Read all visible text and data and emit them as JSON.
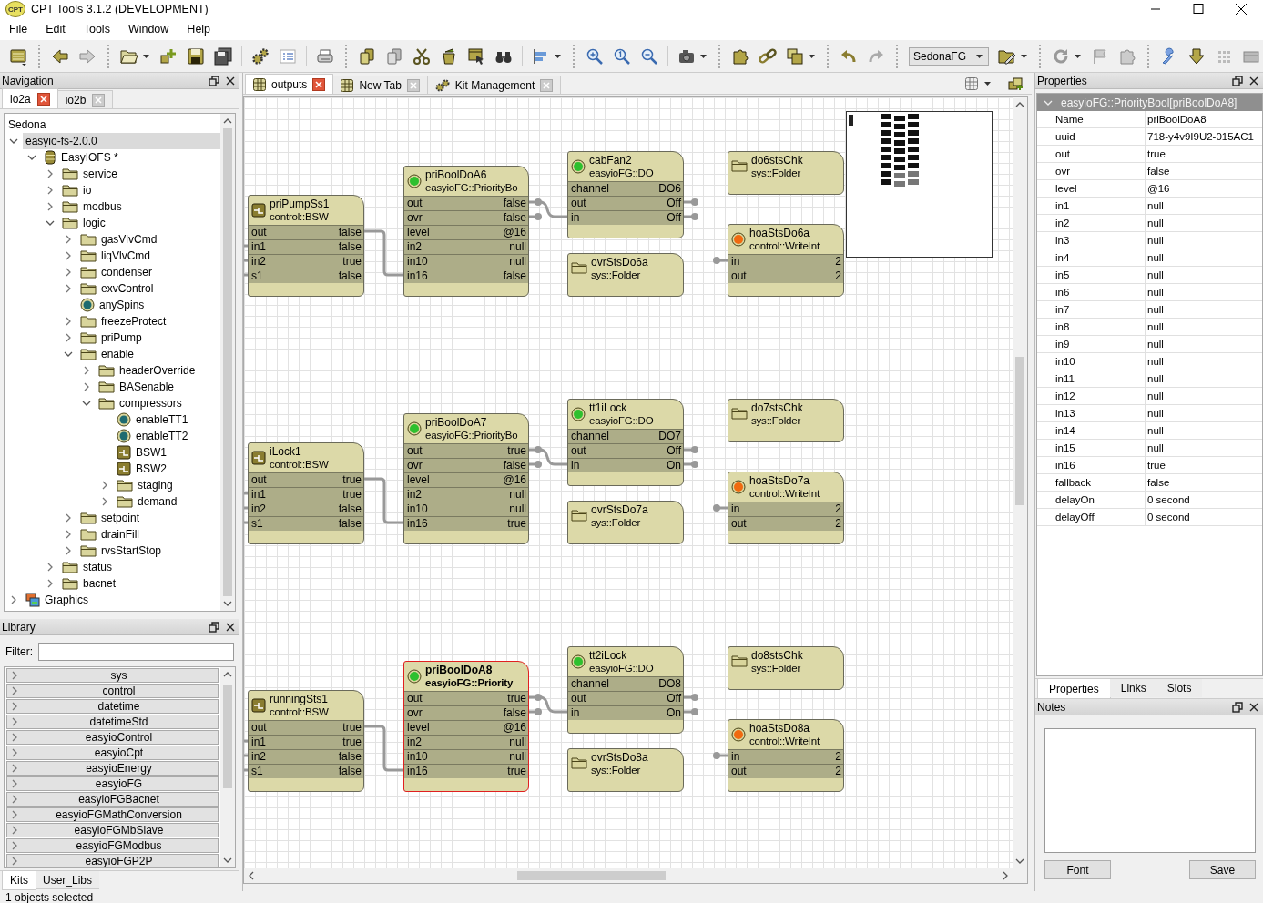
{
  "window": {
    "title": "CPT Tools 3.1.2 (DEVELOPMENT)",
    "logo_text": "CPT"
  },
  "menu": [
    "File",
    "Edit",
    "Tools",
    "Window",
    "Help"
  ],
  "toolbar": {
    "platform": "SedonaFG"
  },
  "navigation": {
    "title": "Navigation",
    "tabs": [
      {
        "label": "io2a",
        "selected": true
      },
      {
        "label": "io2b",
        "selected": false
      }
    ],
    "root": "Sedona",
    "tree": [
      {
        "label": "easyio-fs-2.0.0",
        "expanded": true,
        "selected": true,
        "children": [
          {
            "label": "EasyIOFS *",
            "kind": "database",
            "expanded": true,
            "selected": false,
            "children": [
              {
                "label": "service",
                "kind": "folder",
                "expanded": false,
                "selected": false
              },
              {
                "label": "io",
                "kind": "folder",
                "expanded": false,
                "selected": false
              },
              {
                "label": "modbus",
                "kind": "folder",
                "expanded": false,
                "selected": false
              },
              {
                "label": "logic",
                "kind": "folder",
                "expanded": true,
                "selected": false,
                "children": [
                  {
                    "label": "gasVlvCmd",
                    "kind": "folder",
                    "expanded": false,
                    "selected": false
                  },
                  {
                    "label": "liqVlvCmd",
                    "kind": "folder",
                    "expanded": false,
                    "selected": false
                  },
                  {
                    "label": "condenser",
                    "kind": "folder",
                    "expanded": false,
                    "selected": false
                  },
                  {
                    "label": "exvControl",
                    "kind": "folder",
                    "expanded": false,
                    "selected": false
                  },
                  {
                    "label": "anySpins",
                    "kind": "point",
                    "selected": false
                  },
                  {
                    "label": "freezeProtect",
                    "kind": "folder",
                    "expanded": false,
                    "selected": false
                  },
                  {
                    "label": "priPump",
                    "kind": "folder",
                    "expanded": false,
                    "selected": false
                  },
                  {
                    "label": "enable",
                    "kind": "folder",
                    "expanded": true,
                    "selected": false,
                    "children": [
                      {
                        "label": "headerOverride",
                        "kind": "folder",
                        "expanded": false,
                        "selected": false
                      },
                      {
                        "label": "BASenable",
                        "kind": "folder",
                        "expanded": false,
                        "selected": false
                      },
                      {
                        "label": "compressors",
                        "kind": "folder",
                        "expanded": true,
                        "selected": false,
                        "children": [
                          {
                            "label": "enableTT1",
                            "kind": "point",
                            "selected": false
                          },
                          {
                            "label": "enableTT2",
                            "kind": "point",
                            "selected": false
                          },
                          {
                            "label": "BSW1",
                            "kind": "bsw",
                            "selected": false
                          },
                          {
                            "label": "BSW2",
                            "kind": "bsw",
                            "selected": false
                          },
                          {
                            "label": "staging",
                            "kind": "folder",
                            "expanded": false,
                            "selected": false
                          },
                          {
                            "label": "demand",
                            "kind": "folder",
                            "expanded": false,
                            "selected": false
                          }
                        ]
                      }
                    ]
                  },
                  {
                    "label": "setpoint",
                    "kind": "folder",
                    "expanded": false,
                    "selected": false
                  },
                  {
                    "label": "drainFill",
                    "kind": "folder",
                    "expanded": false,
                    "selected": false
                  },
                  {
                    "label": "rvsStartStop",
                    "kind": "folder",
                    "expanded": false,
                    "selected": false
                  }
                ]
              },
              {
                "label": "status",
                "kind": "folder",
                "expanded": false,
                "selected": false
              },
              {
                "label": "bacnet",
                "kind": "folder",
                "expanded": false,
                "selected": false
              }
            ]
          }
        ]
      },
      {
        "label": "Graphics",
        "kind": "graphics",
        "expanded": false,
        "selected": false
      }
    ]
  },
  "library": {
    "title": "Library",
    "filter_label": "Filter:",
    "kits": [
      "sys",
      "control",
      "datetime",
      "datetimeStd",
      "easyioControl",
      "easyioCpt",
      "easyioEnergy",
      "easyioFG",
      "easyioFGBacnet",
      "easyioFGMathConversion",
      "easyioFGMbSlave",
      "easyioFGModbus",
      "easyioFGP2P"
    ],
    "tabs": [
      {
        "label": "Kits",
        "selected": true
      },
      {
        "label": "User_Libs",
        "selected": false
      }
    ]
  },
  "editor_tabs": [
    {
      "label": "outputs",
      "kind": "grid",
      "selected": true
    },
    {
      "label": "New Tab",
      "kind": "grid",
      "selected": false
    },
    {
      "label": "Kit Management",
      "kind": "gears",
      "selected": false
    }
  ],
  "nodes": [
    {
      "name": "priPumpSs1",
      "type": "control::BSW",
      "kind": "bsw",
      "selected": false,
      "rows": [
        {
          "label": "out",
          "value": "false"
        },
        {
          "label": "in1",
          "value": "false"
        },
        {
          "label": "in2",
          "value": "true"
        },
        {
          "label": "s1",
          "value": "false"
        }
      ]
    },
    {
      "name": "priBoolDoA6",
      "type": "easyioFG::PriorityBo",
      "kind": "ok",
      "selected": false,
      "rows": [
        {
          "label": "out",
          "value": "false"
        },
        {
          "label": "ovr",
          "value": "false"
        },
        {
          "label": "level",
          "value": "@16"
        },
        {
          "label": "in2",
          "value": "null"
        },
        {
          "label": "in10",
          "value": "null"
        },
        {
          "label": "in16",
          "value": "false"
        }
      ]
    },
    {
      "name": "cabFan2",
      "type": "easyioFG::DO",
      "kind": "ok",
      "selected": false,
      "rows": [
        {
          "label": "channel",
          "value": "DO6"
        },
        {
          "label": "out",
          "value": "Off"
        },
        {
          "label": "in",
          "value": "Off"
        }
      ]
    },
    {
      "name": "ovrStsDo6a",
      "type": "sys::Folder",
      "kind": "folder",
      "selected": false
    },
    {
      "name": "do6stsChk",
      "type": "sys::Folder",
      "kind": "folder",
      "selected": false
    },
    {
      "name": "hoaStsDo6a",
      "type": "control::WriteInt",
      "kind": "alarm",
      "selected": false,
      "rows": [
        {
          "label": "in",
          "value": "2"
        },
        {
          "label": "out",
          "value": "2"
        }
      ]
    },
    {
      "name": "iLock1",
      "type": "control::BSW",
      "kind": "bsw",
      "selected": false,
      "rows": [
        {
          "label": "out",
          "value": "true"
        },
        {
          "label": "in1",
          "value": "true"
        },
        {
          "label": "in2",
          "value": "false"
        },
        {
          "label": "s1",
          "value": "false"
        }
      ]
    },
    {
      "name": "priBoolDoA7",
      "type": "easyioFG::PriorityBo",
      "kind": "ok",
      "selected": false,
      "rows": [
        {
          "label": "out",
          "value": "true"
        },
        {
          "label": "ovr",
          "value": "false"
        },
        {
          "label": "level",
          "value": "@16"
        },
        {
          "label": "in2",
          "value": "null"
        },
        {
          "label": "in10",
          "value": "null"
        },
        {
          "label": "in16",
          "value": "true"
        }
      ]
    },
    {
      "name": "tt1iLock",
      "type": "easyioFG::DO",
      "kind": "ok",
      "selected": false,
      "rows": [
        {
          "label": "channel",
          "value": "DO7"
        },
        {
          "label": "out",
          "value": "Off"
        },
        {
          "label": "in",
          "value": "On"
        }
      ]
    },
    {
      "name": "ovrStsDo7a",
      "type": "sys::Folder",
      "kind": "folder",
      "selected": false
    },
    {
      "name": "do7stsChk",
      "type": "sys::Folder",
      "kind": "folder",
      "selected": false
    },
    {
      "name": "hoaStsDo7a",
      "type": "control::WriteInt",
      "kind": "alarm",
      "selected": false,
      "rows": [
        {
          "label": "in",
          "value": "2"
        },
        {
          "label": "out",
          "value": "2"
        }
      ]
    },
    {
      "name": "runningSts1",
      "type": "control::BSW",
      "kind": "bsw",
      "selected": false,
      "rows": [
        {
          "label": "out",
          "value": "true"
        },
        {
          "label": "in1",
          "value": "true"
        },
        {
          "label": "in2",
          "value": "false"
        },
        {
          "label": "s1",
          "value": "false"
        }
      ]
    },
    {
      "name": "priBoolDoA8",
      "type": "easyioFG::Priority",
      "kind": "ok",
      "selected": true,
      "rows": [
        {
          "label": "out",
          "value": "true"
        },
        {
          "label": "ovr",
          "value": "false"
        },
        {
          "label": "level",
          "value": "@16"
        },
        {
          "label": "in2",
          "value": "null"
        },
        {
          "label": "in10",
          "value": "null"
        },
        {
          "label": "in16",
          "value": "true"
        }
      ]
    },
    {
      "name": "tt2iLock",
      "type": "easyioFG::DO",
      "kind": "ok",
      "selected": false,
      "rows": [
        {
          "label": "channel",
          "value": "DO8"
        },
        {
          "label": "out",
          "value": "Off"
        },
        {
          "label": "in",
          "value": "On"
        }
      ]
    },
    {
      "name": "ovrStsDo8a",
      "type": "sys::Folder",
      "kind": "folder",
      "selected": false
    },
    {
      "name": "do8stsChk",
      "type": "sys::Folder",
      "kind": "folder",
      "selected": false
    },
    {
      "name": "hoaStsDo8a",
      "type": "control::WriteInt",
      "kind": "alarm",
      "selected": false,
      "rows": [
        {
          "label": "in",
          "value": "2"
        },
        {
          "label": "out",
          "value": "2"
        }
      ]
    }
  ],
  "properties": {
    "title": "Properties",
    "object": "easyioFG::PriorityBool[priBoolDoA8]",
    "rows": [
      {
        "name": "Name",
        "value": "priBoolDoA8"
      },
      {
        "name": "uuid",
        "value": "718-y4v9I9U2-015AC1"
      },
      {
        "name": "out",
        "value": "true"
      },
      {
        "name": "ovr",
        "value": "false"
      },
      {
        "name": "level",
        "value": "@16"
      },
      {
        "name": "in1",
        "value": "null"
      },
      {
        "name": "in2",
        "value": "null"
      },
      {
        "name": "in3",
        "value": "null"
      },
      {
        "name": "in4",
        "value": "null"
      },
      {
        "name": "in5",
        "value": "null"
      },
      {
        "name": "in6",
        "value": "null"
      },
      {
        "name": "in7",
        "value": "null"
      },
      {
        "name": "in8",
        "value": "null"
      },
      {
        "name": "in9",
        "value": "null"
      },
      {
        "name": "in10",
        "value": "null"
      },
      {
        "name": "in11",
        "value": "null"
      },
      {
        "name": "in12",
        "value": "null"
      },
      {
        "name": "in13",
        "value": "null"
      },
      {
        "name": "in14",
        "value": "null"
      },
      {
        "name": "in15",
        "value": "null"
      },
      {
        "name": "in16",
        "value": "true"
      },
      {
        "name": "fallback",
        "value": "false"
      },
      {
        "name": "delayOn",
        "value": "0 second"
      },
      {
        "name": "delayOff",
        "value": "0 second"
      }
    ],
    "tabs": [
      {
        "label": "Properties",
        "selected": true
      },
      {
        "label": "Links",
        "selected": false
      },
      {
        "label": "Slots",
        "selected": false
      }
    ]
  },
  "notes": {
    "title": "Notes",
    "buttons": [
      "Font",
      "Save"
    ]
  },
  "status_bar": "1 objects selected"
}
